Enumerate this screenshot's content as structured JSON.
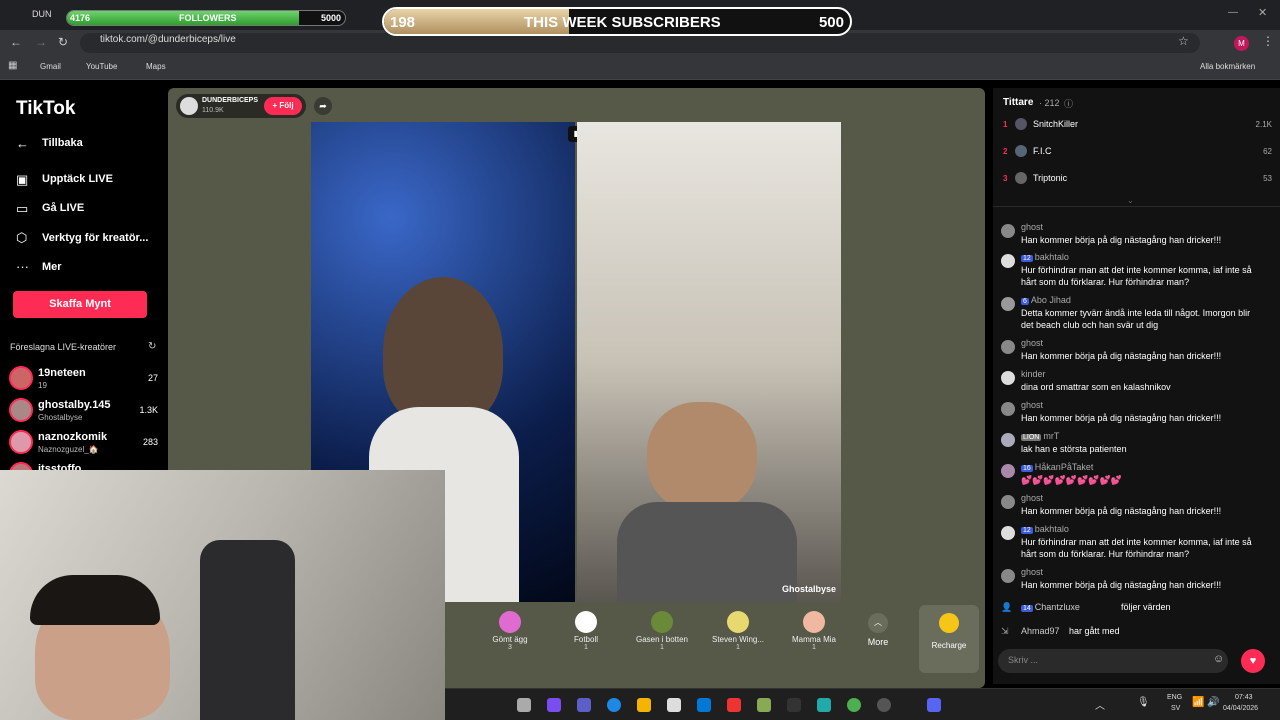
{
  "browser": {
    "url": "tiktok.com/@dunderbiceps/live",
    "bookmarks": [
      "Gmail",
      "YouTube",
      "Maps"
    ],
    "all_bookmarks": "Alla bokmärken",
    "profile_initial": "M",
    "tab_label": "DUN"
  },
  "overlays": {
    "followers": {
      "label": "FOLLOWERS",
      "current": "4176",
      "goal": "5000",
      "progress": 0.835
    },
    "subscribers": {
      "label": "THIS WEEK SUBSCRIBERS",
      "current": "198",
      "goal": "500",
      "progress": 0.396
    }
  },
  "sidebar": {
    "logo": "TikTok",
    "back": "Tillbaka",
    "items": [
      {
        "label": "Upptäck LIVE",
        "icon": "live-discover-icon"
      },
      {
        "label": "Gå LIVE",
        "icon": "camera-icon"
      },
      {
        "label": "Verktyg för kreatör...",
        "icon": "creator-tools-icon"
      },
      {
        "label": "Mer",
        "icon": "more-icon"
      }
    ],
    "buy_button": "Skaffa Mynt",
    "suggested_title": "Föreslagna LIVE-kreatörer",
    "creators": [
      {
        "name": "19neteen",
        "sub": "19",
        "count": "27"
      },
      {
        "name": "ghostalby.145",
        "sub": "Ghostalbyse",
        "count": "1.3K"
      },
      {
        "name": "naznozkomik",
        "sub": "Naznozguzel_🏠",
        "count": "283"
      },
      {
        "name": "itsstoffo",
        "sub": "",
        "count": ""
      }
    ]
  },
  "stream": {
    "host": "DUNDERBICEPS",
    "likes": "110.9K",
    "follow": "+ Följ",
    "watermark": "Ghostalbyse",
    "gifts": [
      {
        "name": "Gömt ägg",
        "price": "3",
        "color": "#e06bd0"
      },
      {
        "name": "Fotboll",
        "price": "1",
        "color": "#ffffff"
      },
      {
        "name": "Gasen i botten",
        "price": "1",
        "color": "#6a8a3a"
      },
      {
        "name": "Steven Wing...",
        "price": "1",
        "color": "#e8d870"
      },
      {
        "name": "Mamma Mia",
        "price": "1",
        "color": "#f0b8a0"
      }
    ],
    "more": "More",
    "recharge": "Recharge"
  },
  "panel": {
    "viewers_label": "Tittare",
    "viewers_count": "· 212",
    "top": [
      {
        "rank": "1",
        "name": "SnitchKiller",
        "value": "2.1K"
      },
      {
        "rank": "2",
        "name": "F.I.C",
        "value": "62"
      },
      {
        "rank": "3",
        "name": "Triptonic",
        "value": "53"
      }
    ],
    "chat": [
      {
        "user": "ghost",
        "badge": "",
        "msg": "Han kommer börja på dig nästagång han dricker!!!"
      },
      {
        "user": "bakhtalo",
        "badge": "12",
        "msg": "Hur förhindrar man att det inte kommer komma, iaf inte så hårt som du förklarar. Hur förhindrar man?"
      },
      {
        "user": "Abo Jihad",
        "badge": "6",
        "msg": "Detta kommer tyvärr ändå inte leda till något. Imorgon blir det beach club och han svär ut dig"
      },
      {
        "user": "ghost",
        "badge": "",
        "msg": "Han kommer börja på dig nästagång han dricker!!!"
      },
      {
        "user": "kinder",
        "badge": "",
        "msg": "dina ord smattrar som en kalashnikov"
      },
      {
        "user": "ghost",
        "badge": "",
        "msg": "Han kommer börja på dig nästagång han dricker!!!"
      },
      {
        "user": "mrT",
        "badge": "LION",
        "msg": "lak han e största patienten"
      },
      {
        "user": "HåkanPåTaket",
        "badge": "16",
        "msg": "💕💕💕💕💕💕💕💕💕"
      },
      {
        "user": "ghost",
        "badge": "",
        "msg": "Han kommer börja på dig nästagång han dricker!!!"
      },
      {
        "user": "bakhtalo",
        "badge": "12",
        "msg": "Hur förhindrar man att det inte kommer komma, iaf inte så hårt som du förklarar. Hur förhindrar man?"
      },
      {
        "user": "ghost",
        "badge": "",
        "msg": "Han kommer börja på dig nästagång han dricker!!!"
      }
    ],
    "follow_event": {
      "user": "Chantzluxe",
      "badge": "14",
      "text": "följer värden"
    },
    "join_event": {
      "user": "Ahmad97",
      "text": "har gått med"
    },
    "input_placeholder": "Skriv ..."
  },
  "taskbar": {
    "lang": "ENG",
    "region": "SV",
    "time": "07:43",
    "date": "04/04/2026"
  }
}
